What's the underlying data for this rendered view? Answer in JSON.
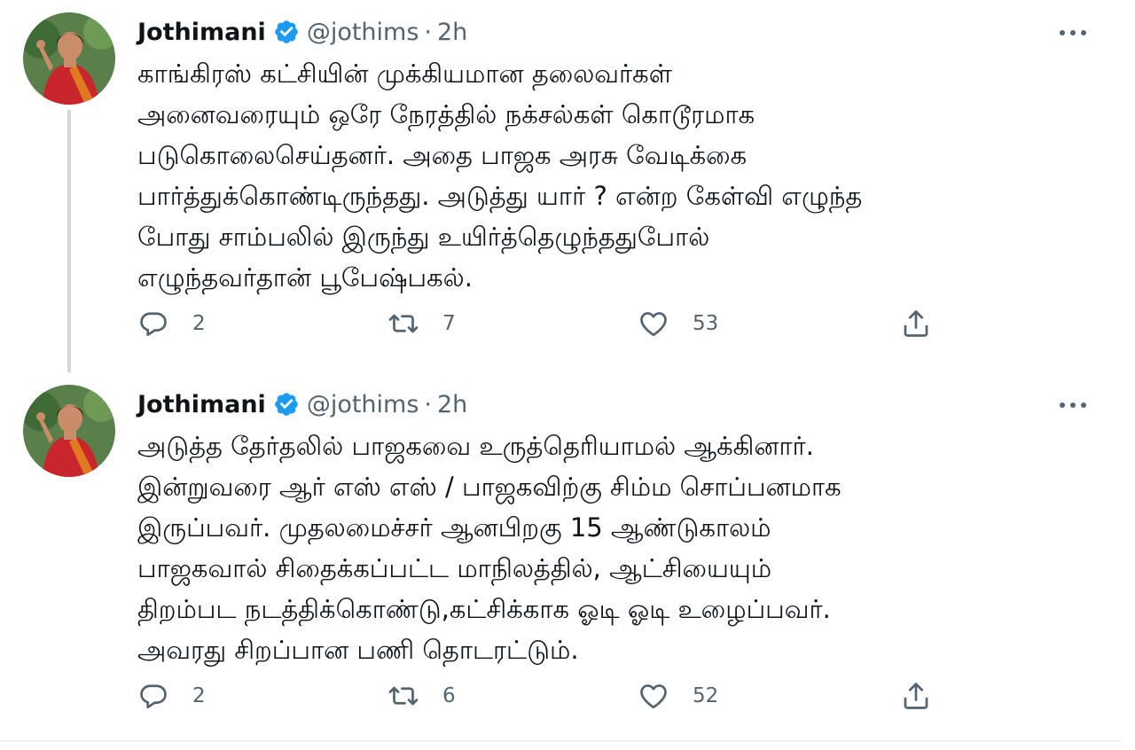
{
  "tweets": [
    {
      "author": {
        "name": "Jothimani",
        "handle": "@jothims",
        "separator": "·",
        "time": "2h"
      },
      "lines": [
        "காங்கிரஸ் கட்சியின் முக்கியமான தலைவர்கள்",
        "அனைவரையும் ஒரே நேரத்தில் நக்சல்கள் கொடூரமாக",
        "படுகொலைசெய்தனர். அதை பாஜக அரசு வேடிக்கை",
        "பார்த்துக்கொண்டிருந்தது. அடுத்து யார் ? என்ற கேள்வி எழுந்த",
        "போது சாம்பலில் இருந்து உயிர்த்தெழுந்ததுபோல்",
        "எழுந்தவர்தான் பூபேஷ்பகல்."
      ],
      "stats": {
        "replies": "2",
        "retweets": "7",
        "likes": "53"
      }
    },
    {
      "author": {
        "name": "Jothimani",
        "handle": "@jothims",
        "separator": "·",
        "time": "2h"
      },
      "lines": [
        "அடுத்த தேர்தலில் பாஜகவை உருத்தெரியாமல் ஆக்கினார்.",
        "இன்றுவரை ஆர் எஸ் எஸ் / பாஜகவிற்கு சிம்ம சொப்பனமாக",
        "இருப்பவர். முதலமைச்சர் ஆனபிறகு 15 ஆண்டுகாலம்",
        "பாஜகவால் சிதைக்கப்பட்ட மாநிலத்தில், ஆட்சியையும்",
        "திறம்பட நடத்திக்கொண்டு,கட்சிக்காக ஓடி ஓடி உழைப்பவர்.",
        "அவரது சிறப்பான பணி தொடரட்டும்."
      ],
      "stats": {
        "replies": "2",
        "retweets": "6",
        "likes": "52"
      }
    }
  ],
  "colors": {
    "verified": "#1d9bf0",
    "secondary_text": "#536471",
    "thread_line": "#cfd9de"
  },
  "icons": {
    "avatar": "profile-photo",
    "verified": "verified-badge-icon",
    "more": "more-options-icon",
    "reply": "reply-icon",
    "retweet": "retweet-icon",
    "like": "heart-icon",
    "share": "share-icon"
  }
}
